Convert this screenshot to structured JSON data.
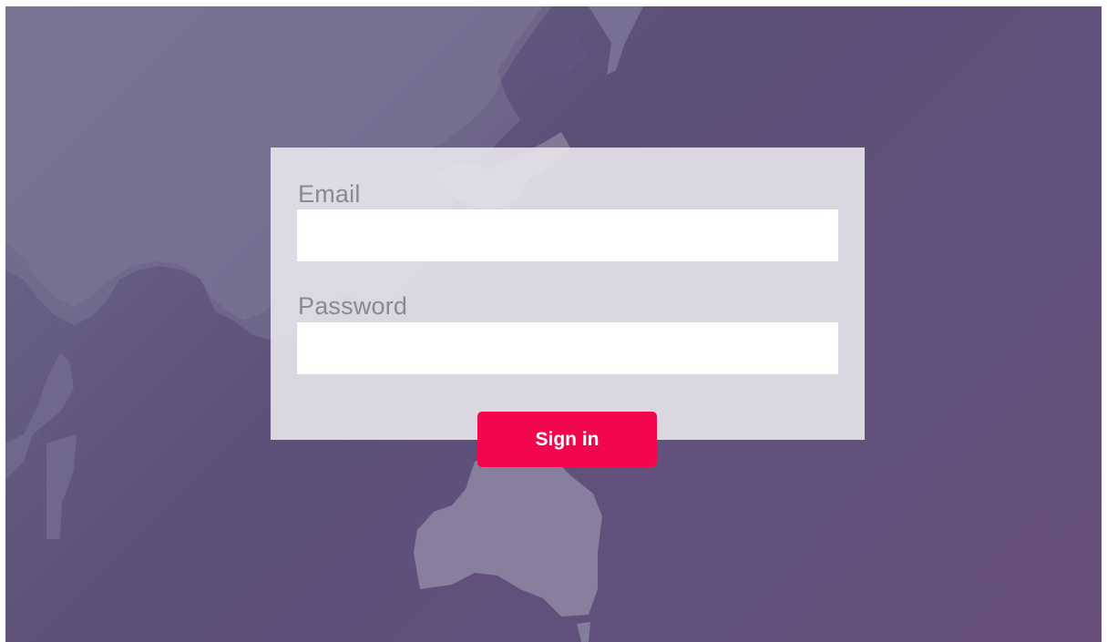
{
  "login_form": {
    "email_label": "Email",
    "email_value": "",
    "password_label": "Password",
    "password_value": "",
    "submit_label": "Sign in"
  },
  "theme": {
    "background": "#5c5078",
    "card_background": "#e8e5ec",
    "label_color": "#8a8796",
    "button_color": "#f2064e",
    "button_text_color": "#ffffff"
  },
  "background_art": {
    "icon": "world-map-icon"
  }
}
